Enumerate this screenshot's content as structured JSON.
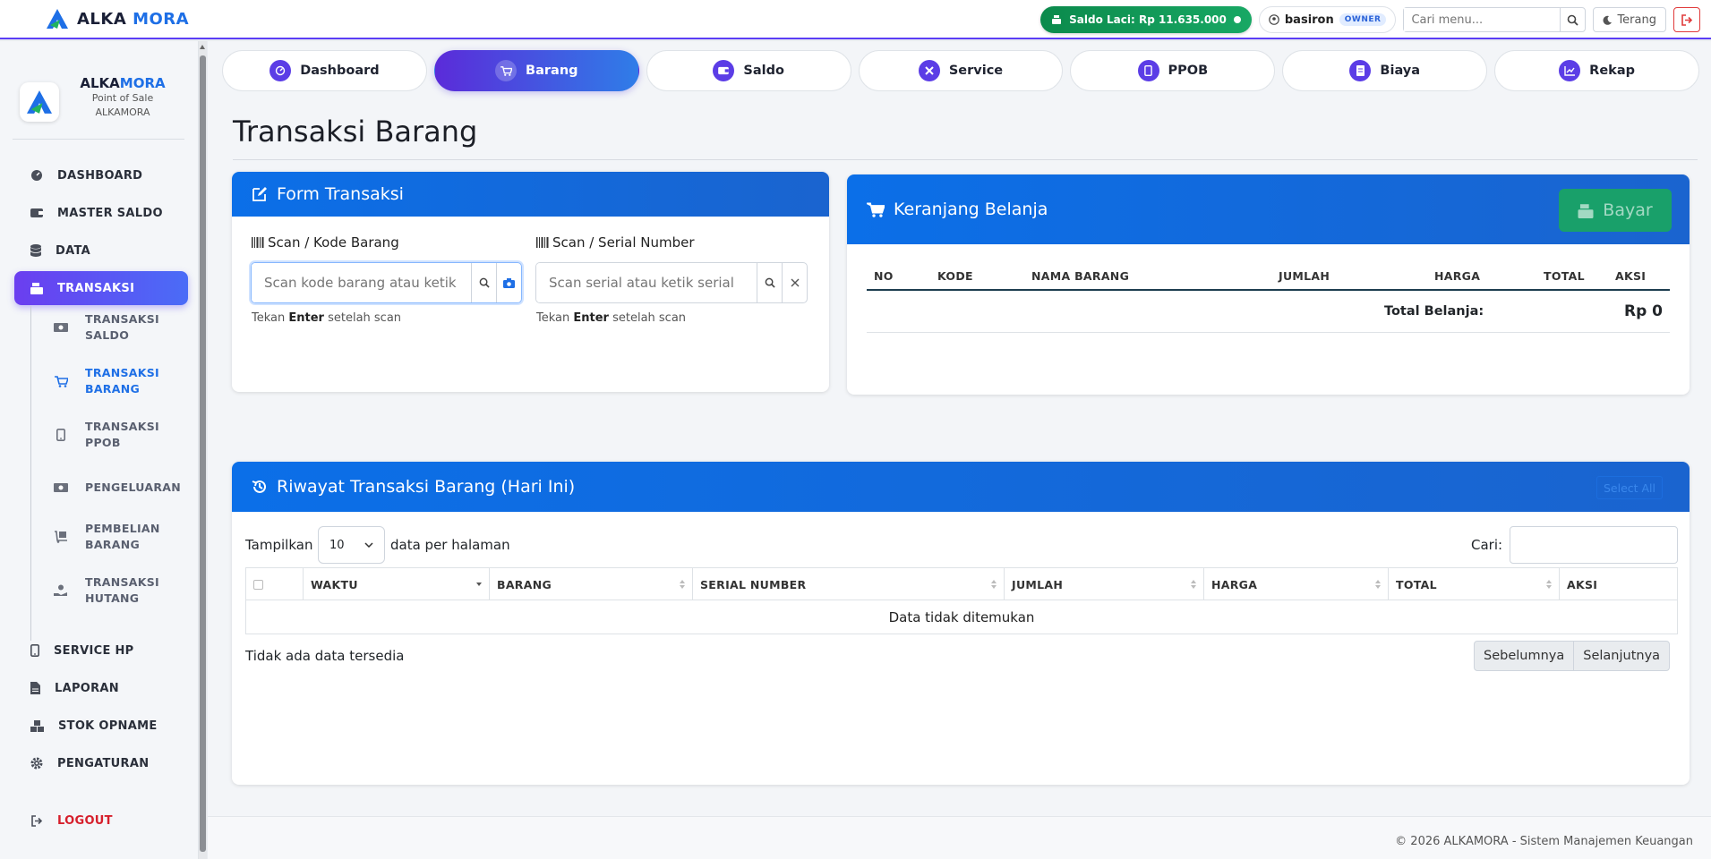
{
  "app": {
    "brand_left": "ALKA",
    "brand_right": "MORA",
    "brand_sub1": "Point of Sale",
    "brand_sub2": "ALKAMORA"
  },
  "topbar": {
    "saldo_label": "Saldo Laci: Rp 11.635.000",
    "username": "basiron",
    "role_badge": "OWNER",
    "search_placeholder": "Cari menu...",
    "theme_label": "Terang"
  },
  "sidebar": {
    "items": [
      {
        "label": "DASHBOARD",
        "icon": "speedometer-icon"
      },
      {
        "label": "MASTER SALDO",
        "icon": "wallet-icon"
      },
      {
        "label": "DATA",
        "icon": "database-icon"
      },
      {
        "label": "TRANSAKSI",
        "icon": "cash-register-icon"
      },
      {
        "label": "SERVICE HP",
        "icon": "mobile-icon"
      },
      {
        "label": "LAPORAN",
        "icon": "file-icon"
      },
      {
        "label": "STOK OPNAME",
        "icon": "boxes-icon"
      },
      {
        "label": "PENGATURAN",
        "icon": "gear-icon"
      },
      {
        "label": "LOGOUT",
        "icon": "logout-icon"
      }
    ],
    "sub_items": [
      {
        "line1": "TRANSAKSI",
        "line2": "SALDO"
      },
      {
        "line1": "TRANSAKSI",
        "line2": "BARANG"
      },
      {
        "line1": "TRANSAKSI",
        "line2": "PPOB"
      },
      {
        "line1": "PENGELUARAN",
        "line2": ""
      },
      {
        "line1": "PEMBELIAN",
        "line2": "BARANG"
      },
      {
        "line1": "TRANSAKSI",
        "line2": "HUTANG"
      }
    ]
  },
  "tabs": [
    {
      "label": "Dashboard"
    },
    {
      "label": "Barang"
    },
    {
      "label": "Saldo"
    },
    {
      "label": "Service"
    },
    {
      "label": "PPOB"
    },
    {
      "label": "Biaya"
    },
    {
      "label": "Rekap"
    }
  ],
  "page_title": "Transaksi Barang",
  "form": {
    "title": "Form Transaksi",
    "kode_label": "Scan / Kode Barang",
    "kode_placeholder": "Scan kode barang atau ketik kode",
    "kode_help_pre": "Tekan ",
    "kode_help_key": "Enter",
    "kode_help_post": " setelah scan",
    "serial_label": "Scan / Serial Number",
    "serial_placeholder": "Scan serial atau ketik serial",
    "serial_help_pre": "Tekan ",
    "serial_help_key": "Enter",
    "serial_help_post": " setelah scan"
  },
  "cart": {
    "title": "Keranjang Belanja",
    "bayar_label": "Bayar",
    "columns": [
      "NO",
      "KODE",
      "NAMA BARANG",
      "JUMLAH",
      "HARGA",
      "TOTAL",
      "AKSI"
    ],
    "total_label": "Total Belanja:",
    "total_value": "Rp 0"
  },
  "history": {
    "title": "Riwayat Transaksi Barang (Hari Ini)",
    "select_all_label": "Select All",
    "show_label": "Tampilkan",
    "page_size": "10",
    "per_page_label": "data per halaman",
    "search_label": "Cari:",
    "columns": [
      "WAKTU",
      "BARANG",
      "SERIAL NUMBER",
      "JUMLAH",
      "HARGA",
      "TOTAL",
      "AKSI"
    ],
    "empty_message": "Data tidak ditemukan",
    "info": "Tidak ada data tersedia",
    "prev_label": "Sebelumnya",
    "next_label": "Selanjutnya"
  },
  "footer": {
    "text": "© 2026 ALKAMORA - Sistem Manajemen Keuangan"
  },
  "colors": {
    "primary": "#0b6fe8",
    "accent_purple": "#5b3de6",
    "success": "#19a06a",
    "danger": "#d61f2c"
  }
}
